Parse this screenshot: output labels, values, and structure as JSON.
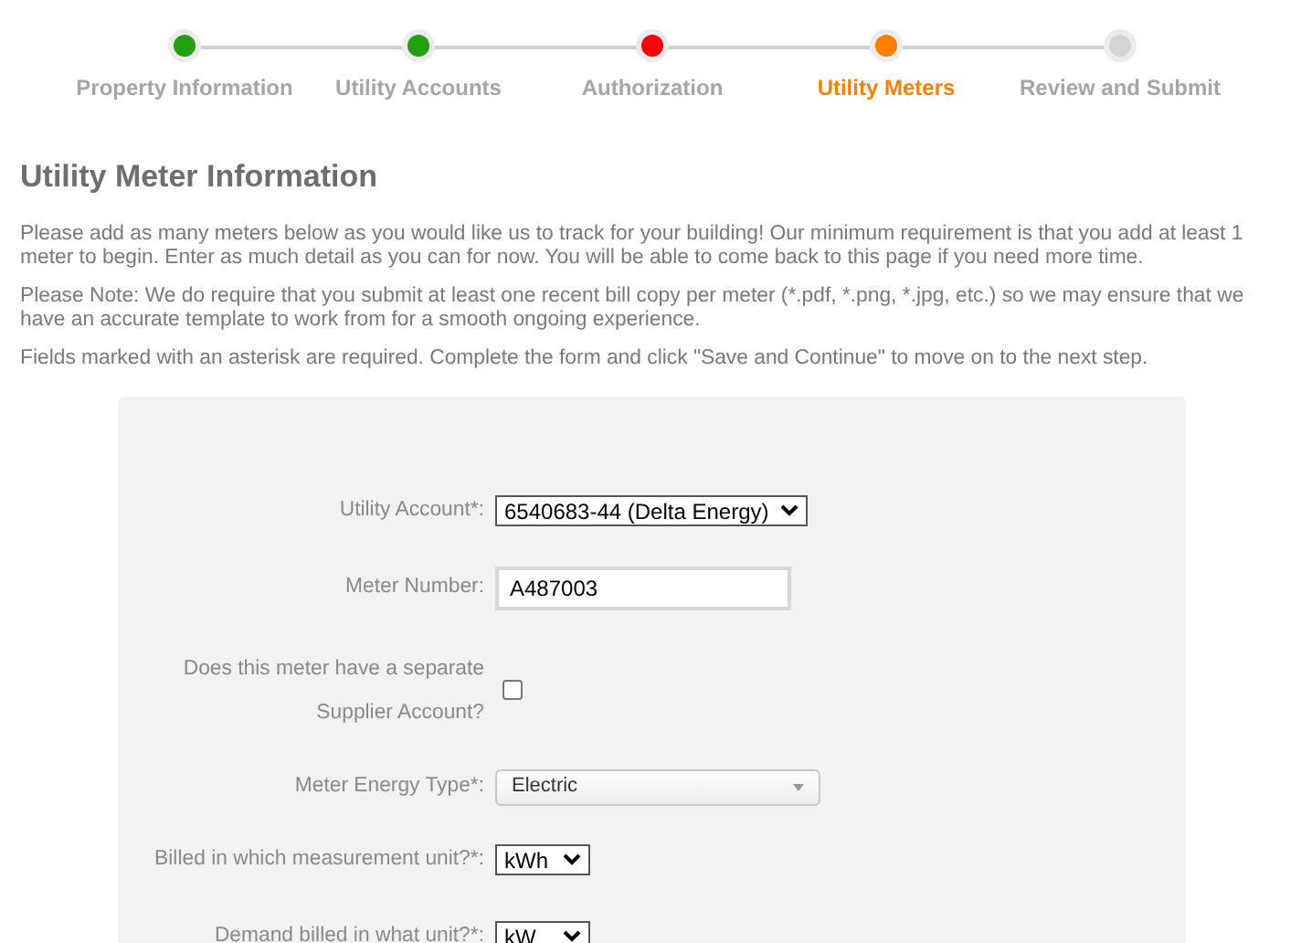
{
  "steps": [
    {
      "label": "Property Information",
      "color": "#22a010",
      "selected": false
    },
    {
      "label": "Utility Accounts",
      "color": "#22a010",
      "selected": false
    },
    {
      "label": "Authorization",
      "color": "#ff0000",
      "selected": false
    },
    {
      "label": "Utility Meters",
      "color": "#ff8000",
      "selected": true
    },
    {
      "label": "Review and Submit",
      "color": "#d4d4d4",
      "selected": false
    }
  ],
  "heading": "Utility Meter Information",
  "paragraphs": [
    "Please add as many meters below as you would like us to track for your building! Our minimum requirement is that you add at least 1 meter to begin. Enter as much detail as you can for now. You will be able to come back to this page if you need more time.",
    "Please Note: We do require that you submit at least one recent bill copy per meter (*.pdf, *.png, *.jpg, etc.) so we may ensure that we have an accurate template to work from for a smooth ongoing experience.",
    "Fields marked with an asterisk are required. Complete the form and click \"Save and Continue\" to move on to the next step."
  ],
  "form": [
    {
      "kind": "select",
      "label": "Utility Account*:",
      "value": "6540683-44 (Delta Energy)"
    },
    {
      "kind": "text",
      "label": "Meter Number:",
      "value": "A487003"
    },
    {
      "kind": "checkbox",
      "label": "Does this meter have a separate Supplier Account?",
      "checked": false
    },
    {
      "kind": "styled-select",
      "label": "Meter Energy Type*:",
      "value": "Electric"
    },
    {
      "kind": "select",
      "label": "Billed in which measurement unit?*:",
      "value": "kWh"
    },
    {
      "kind": "select",
      "label": "Demand billed in what unit?*:",
      "value": "kW"
    }
  ]
}
